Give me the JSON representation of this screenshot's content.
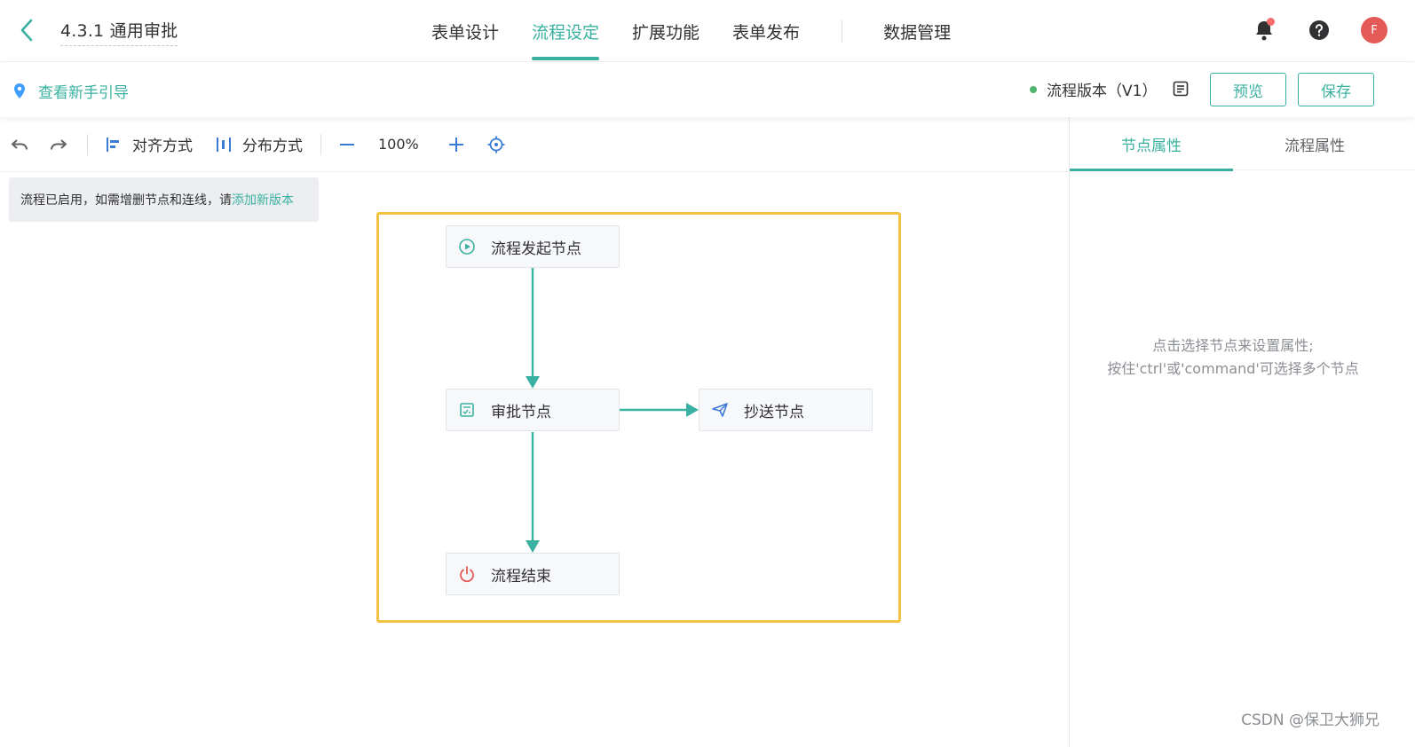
{
  "header": {
    "title": "4.3.1 通用审批",
    "tabs": [
      {
        "label": "表单设计",
        "active": false
      },
      {
        "label": "流程设定",
        "active": true
      },
      {
        "label": "扩展功能",
        "active": false
      },
      {
        "label": "表单发布",
        "active": false
      },
      {
        "label": "数据管理",
        "active": false
      }
    ],
    "avatar_initial": "F",
    "accent_color": "#3ab1a0"
  },
  "subbar": {
    "guide_label": "查看新手引导",
    "version_label": "流程版本（V1）",
    "preview_label": "预览",
    "save_label": "保存"
  },
  "toolbar": {
    "align_label": "对齐方式",
    "distribute_label": "分布方式",
    "zoom": "100%"
  },
  "canvas": {
    "notice_text": "流程已启用，如需增删节点和连线，请",
    "notice_link": "添加新版本",
    "nodes": {
      "start": "流程发起节点",
      "approve": "审批节点",
      "cc": "抄送节点",
      "end": "流程结束"
    }
  },
  "panel": {
    "tabs": [
      "节点属性",
      "流程属性"
    ],
    "hint_line1": "点击选择节点来设置属性;",
    "hint_line2": "按住'ctrl'或'command'可选择多个节点"
  },
  "watermark": "CSDN @保卫大狮兄"
}
